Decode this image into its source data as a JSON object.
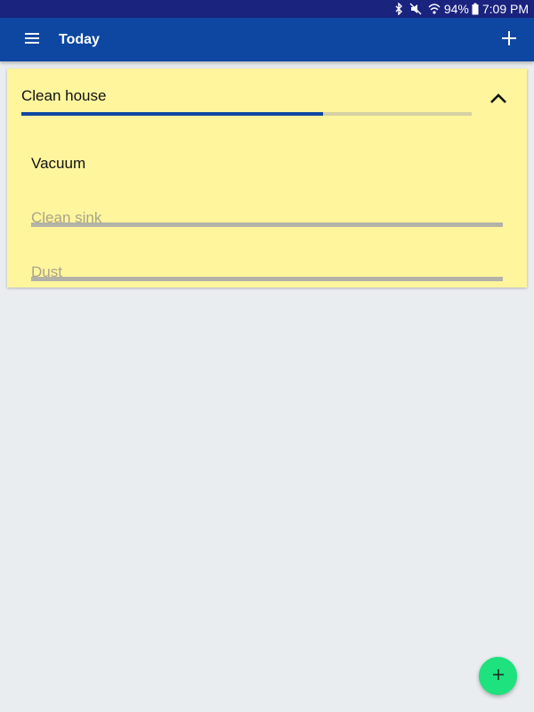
{
  "status_bar": {
    "battery": "94%",
    "time": "7:09 PM",
    "icons": [
      "bluetooth-icon",
      "mute-icon",
      "wifi-icon",
      "battery-icon"
    ]
  },
  "app_bar": {
    "title": "Today",
    "menu_icon": "hamburger-menu-icon",
    "add_icon": "plus-icon"
  },
  "task": {
    "title": "Clean house",
    "progress": 0.67,
    "collapse_icon": "chevron-up-icon",
    "subtasks": [
      {
        "label": "Vacuum",
        "done": false
      },
      {
        "label": "Clean sink",
        "done": true
      },
      {
        "label": "Dust",
        "done": true
      }
    ]
  },
  "fab": {
    "icon": "plus-icon"
  },
  "colors": {
    "status_bar": "#1a237e",
    "app_bar": "#0d47a1",
    "card": "#fff59d",
    "progress": "#0d47a1",
    "fab": "#1de27d",
    "background": "#eaedf0"
  }
}
